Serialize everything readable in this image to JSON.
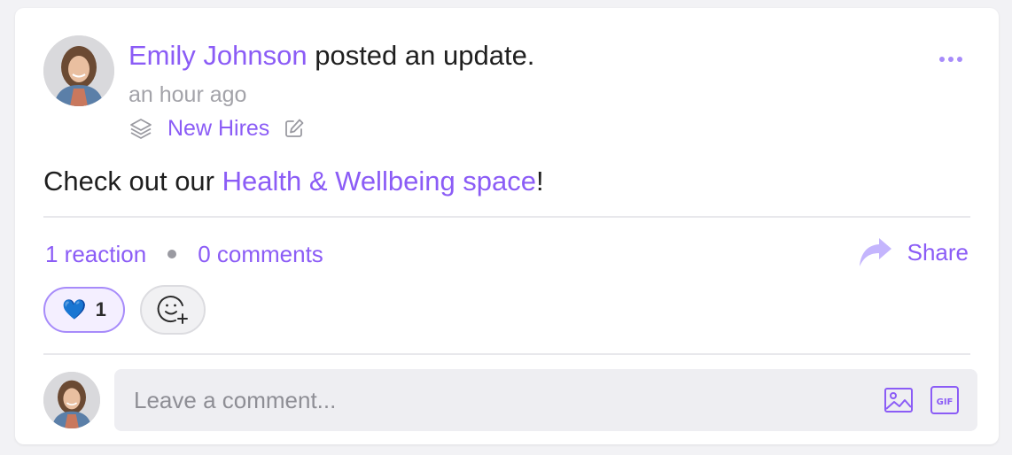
{
  "post": {
    "author": "Emily Johnson",
    "action": " posted an update.",
    "timestamp": "an hour ago",
    "space": "New Hires",
    "body": {
      "prefix": "Check out our ",
      "link": "Health & Wellbeing space",
      "suffix": "!"
    }
  },
  "stats": {
    "reactions": "1 reaction",
    "comments": "0 comments",
    "share_label": "Share"
  },
  "reactions": [
    {
      "emoji": "💙",
      "count": "1"
    }
  ],
  "comment": {
    "placeholder": "Leave a comment..."
  },
  "icons": {
    "more": "more-horizontal-icon",
    "space": "layers-icon",
    "edit": "edit-icon",
    "share": "share-arrow-icon",
    "add_reaction": "add-emoji-icon",
    "image": "image-icon",
    "gif": "gif-icon"
  },
  "colors": {
    "accent": "#8b5cf6",
    "muted": "#a3a3a9",
    "text": "#1f1f1f"
  }
}
